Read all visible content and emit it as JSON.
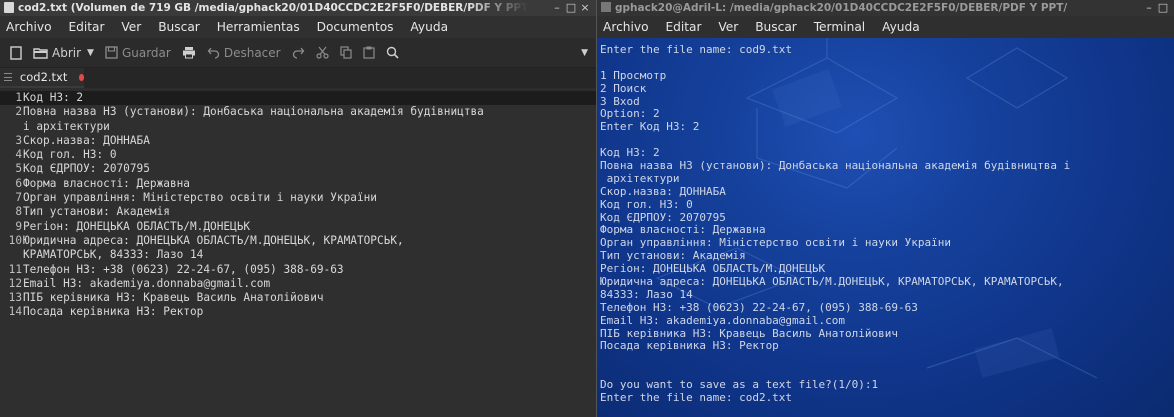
{
  "gedit": {
    "title": "cod2.txt (Volumen de 719 GB /media/gphack20/01D40CCDC2E2F5F0/DEBER/PDF Y PPT",
    "window_controls": [
      "–",
      "□",
      "×"
    ],
    "menu": [
      "Archivo",
      "Editar",
      "Ver",
      "Buscar",
      "Herramientas",
      "Documentos",
      "Ayuda"
    ],
    "toolbar": {
      "open_label": "Abrir",
      "save_label": "Guardar",
      "undo_label": "Deshacer"
    },
    "tab": {
      "label": "cod2.txt"
    },
    "lines": [
      {
        "num": "1",
        "text": "Код НЗ: 2"
      },
      {
        "num": "2",
        "text": "Повна назва НЗ (установи): Донбаська національна академія будівництва"
      },
      {
        "num": "",
        "text": "і архітектури"
      },
      {
        "num": "3",
        "text": "Скор.назва: ДОННАБА"
      },
      {
        "num": "4",
        "text": "Код гол. НЗ: 0"
      },
      {
        "num": "5",
        "text": "Код ЄДРПОУ: 2070795"
      },
      {
        "num": "6",
        "text": "Форма власності: Державна"
      },
      {
        "num": "7",
        "text": "Орган управління: Міністерство освіти і науки України"
      },
      {
        "num": "8",
        "text": "Тип установи: Академія"
      },
      {
        "num": "9",
        "text": "Регіон: ДОНЕЦЬКА ОБЛАСТЬ/М.ДОНЕЦЬК"
      },
      {
        "num": "10",
        "text": "Юридична адреса: ДОНЕЦЬКА ОБЛАСТЬ/М.ДОНЕЦЬК, КРАМАТОРСЬК,"
      },
      {
        "num": "",
        "text": "КРАМАТОРСЬК, 84333: Лазо 14"
      },
      {
        "num": "11",
        "text": "Телефон НЗ: +38 (0623) 22-24-67, (095) 388-69-63"
      },
      {
        "num": "12",
        "text": "Email НЗ: akademiya.donnaba@gmail.com"
      },
      {
        "num": "13",
        "text": "ПІБ керівника НЗ: Кравець Василь Анатолійович"
      },
      {
        "num": "14",
        "text": "Посада керівника НЗ: Ректор"
      }
    ]
  },
  "terminal": {
    "title": "gphack20@Adril-L: /media/gphack20/01D40CCDC2E2F5F0/DEBER/PDF Y PPT/",
    "window_controls": [
      "–",
      "□"
    ],
    "menu": [
      "Archivo",
      "Editar",
      "Ver",
      "Buscar",
      "Terminal",
      "Ayuda"
    ],
    "lines": [
      "Enter the file name: cod9.txt",
      "",
      "1 Просмотр",
      "2 Поиск",
      "3 Вхоd",
      "Option: 2",
      "Enter Код НЗ: 2",
      "",
      "Код НЗ: 2",
      "Повна назва НЗ (установи): Донбаська національна академія будівництва і",
      " архітектури",
      "Скор.назва: ДОННАБА",
      "Код гол. НЗ: 0",
      "Код ЄДРПОУ: 2070795",
      "Форма власності: Державна",
      "Орган управління: Міністерство освіти і науки України",
      "Тип установи: Академія",
      "Регіон: ДОНЕЦЬКА ОБЛАСТЬ/М.ДОНЕЦЬК",
      "Юридична адреса: ДОНЕЦЬКА ОБЛАСТЬ/М.ДОНЕЦЬК, КРАМАТОРСЬК, КРАМАТОРСЬК,",
      "84333: Лазо 14",
      "Телефон НЗ: +38 (0623) 22-24-67, (095) 388-69-63",
      "Email НЗ: akademiya.donnaba@gmail.com",
      "ПІБ керівника НЗ: Кравець Василь Анатолійович",
      "Посада керівника НЗ: Ректор",
      "",
      "",
      "Do you want to save as a text file?(1/0):1",
      "Enter the file name: cod2.txt"
    ]
  }
}
